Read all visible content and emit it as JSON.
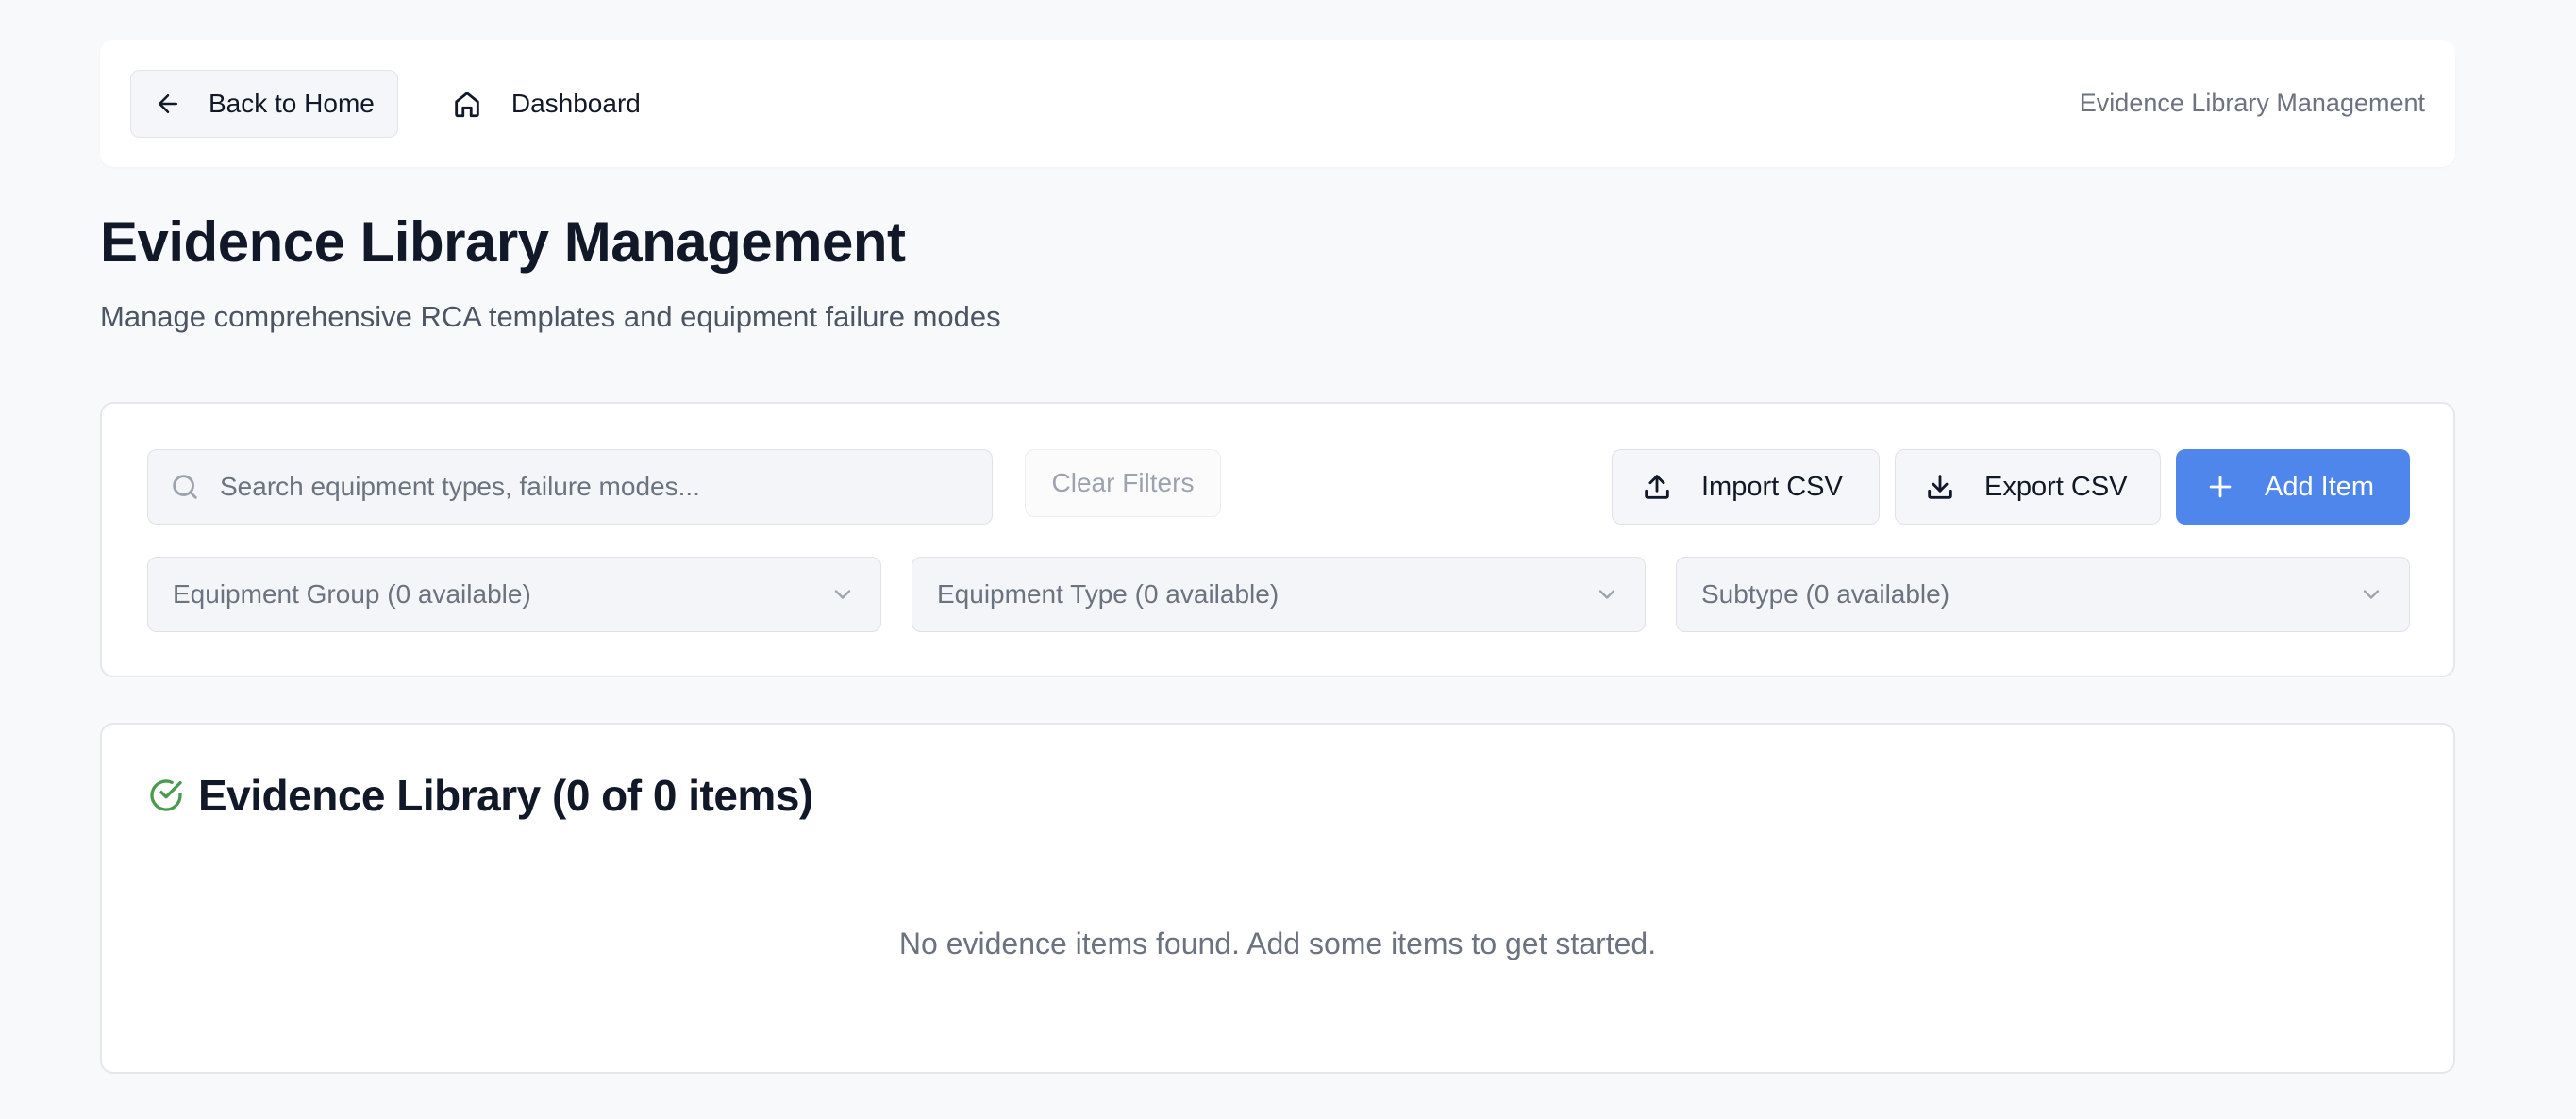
{
  "nav": {
    "back_label": "Back to Home",
    "dashboard_label": "Dashboard",
    "breadcrumb": "Evidence Library Management"
  },
  "page": {
    "title": "Evidence Library Management",
    "subtitle": "Manage comprehensive RCA templates and equipment failure modes"
  },
  "filters": {
    "search_placeholder": "Search equipment types, failure modes...",
    "search_value": "",
    "clear_label": "Clear Filters",
    "import_label": "Import CSV",
    "export_label": "Export CSV",
    "add_label": "Add Item",
    "equipment_group": "Equipment Group (0 available)",
    "equipment_type": "Equipment Type (0 available)",
    "subtype": "Subtype (0 available)"
  },
  "library": {
    "title": "Evidence Library (0 of 0 items)",
    "empty_message": "No evidence items found. Add some items to get started."
  },
  "colors": {
    "accent": "#4f86ec",
    "success_icon": "#4a9a4f",
    "background": "#f8f9fb"
  },
  "icons": [
    "arrow-left-icon",
    "home-icon",
    "search-icon",
    "upload-icon",
    "download-icon",
    "plus-icon",
    "chevron-down-icon",
    "check-circle-icon"
  ]
}
